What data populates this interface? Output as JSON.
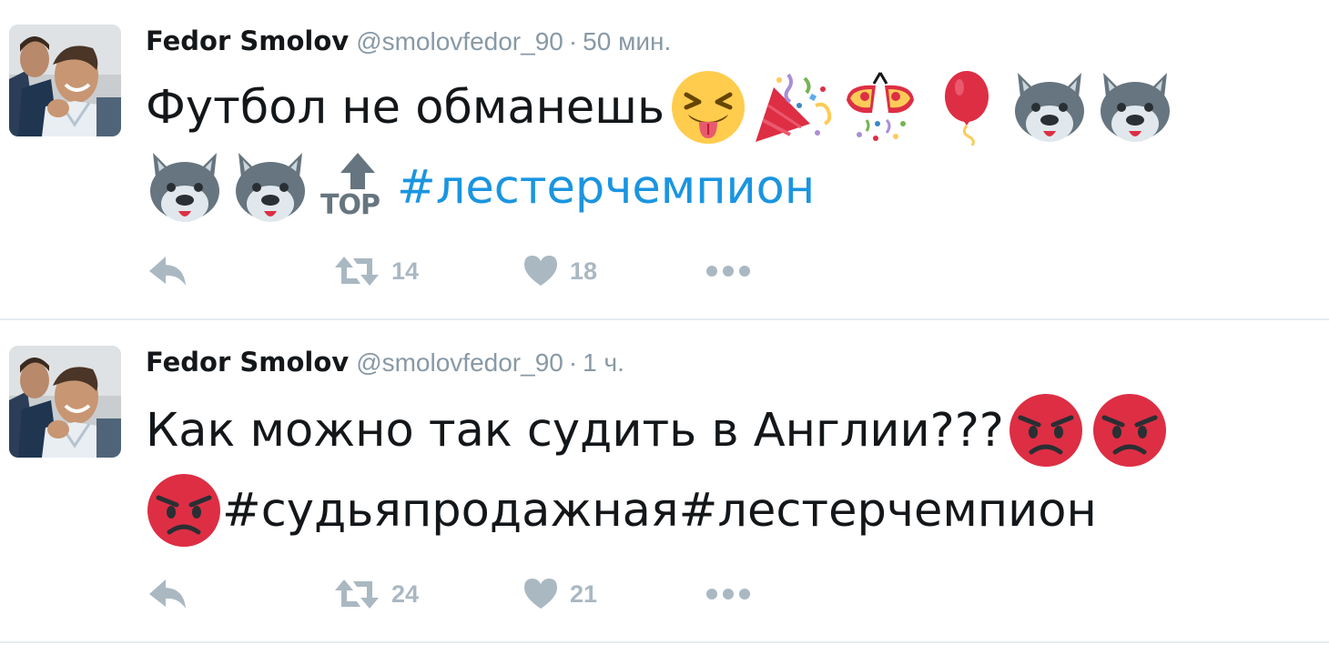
{
  "tweets": [
    {
      "author_name": "Fedor Smolov",
      "handle": "@smolovfedor_90",
      "separator": "·",
      "time": "50 мин.",
      "text_line1": "Футбол не обманешь",
      "top_label": "TOP",
      "hashtag_1": "#лестерчемпион",
      "retweet_count": "14",
      "like_count": "18",
      "emojis": [
        "squinting-tongue-emoji",
        "party-popper-emoji",
        "confetti-ball-emoji",
        "balloon-emoji",
        "wolf-emoji",
        "wolf-emoji",
        "wolf-emoji",
        "wolf-emoji",
        "top-arrow-emoji"
      ]
    },
    {
      "author_name": "Fedor Smolov",
      "handle": "@smolovfedor_90",
      "separator": "·",
      "time": "1 ч.",
      "text_line1": "Как можно так судить в Англии???",
      "hashtag_1": "#судьяпродажная",
      "hashtag_2": "#лестерчемпион",
      "retweet_count": "24",
      "like_count": "21",
      "emojis": [
        "angry-face-emoji",
        "angry-face-emoji",
        "angry-face-emoji"
      ]
    }
  ],
  "icons": [
    "reply-icon",
    "retweet-icon",
    "like-icon",
    "more-icon"
  ],
  "colors": {
    "link": "#1b95e0",
    "muted": "#8899a6",
    "action": "#aab8c2",
    "text": "#14171a",
    "divider": "#e6ecf0"
  }
}
